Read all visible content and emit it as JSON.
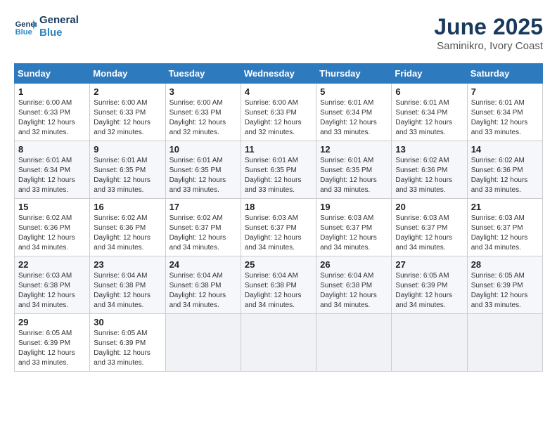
{
  "header": {
    "logo_line1": "General",
    "logo_line2": "Blue",
    "month": "June 2025",
    "location": "Saminikro, Ivory Coast"
  },
  "weekdays": [
    "Sunday",
    "Monday",
    "Tuesday",
    "Wednesday",
    "Thursday",
    "Friday",
    "Saturday"
  ],
  "weeks": [
    [
      {
        "day": "1",
        "info": "Sunrise: 6:00 AM\nSunset: 6:33 PM\nDaylight: 12 hours\nand 32 minutes."
      },
      {
        "day": "2",
        "info": "Sunrise: 6:00 AM\nSunset: 6:33 PM\nDaylight: 12 hours\nand 32 minutes."
      },
      {
        "day": "3",
        "info": "Sunrise: 6:00 AM\nSunset: 6:33 PM\nDaylight: 12 hours\nand 32 minutes."
      },
      {
        "day": "4",
        "info": "Sunrise: 6:00 AM\nSunset: 6:33 PM\nDaylight: 12 hours\nand 32 minutes."
      },
      {
        "day": "5",
        "info": "Sunrise: 6:01 AM\nSunset: 6:34 PM\nDaylight: 12 hours\nand 33 minutes."
      },
      {
        "day": "6",
        "info": "Sunrise: 6:01 AM\nSunset: 6:34 PM\nDaylight: 12 hours\nand 33 minutes."
      },
      {
        "day": "7",
        "info": "Sunrise: 6:01 AM\nSunset: 6:34 PM\nDaylight: 12 hours\nand 33 minutes."
      }
    ],
    [
      {
        "day": "8",
        "info": "Sunrise: 6:01 AM\nSunset: 6:34 PM\nDaylight: 12 hours\nand 33 minutes."
      },
      {
        "day": "9",
        "info": "Sunrise: 6:01 AM\nSunset: 6:35 PM\nDaylight: 12 hours\nand 33 minutes."
      },
      {
        "day": "10",
        "info": "Sunrise: 6:01 AM\nSunset: 6:35 PM\nDaylight: 12 hours\nand 33 minutes."
      },
      {
        "day": "11",
        "info": "Sunrise: 6:01 AM\nSunset: 6:35 PM\nDaylight: 12 hours\nand 33 minutes."
      },
      {
        "day": "12",
        "info": "Sunrise: 6:01 AM\nSunset: 6:35 PM\nDaylight: 12 hours\nand 33 minutes."
      },
      {
        "day": "13",
        "info": "Sunrise: 6:02 AM\nSunset: 6:36 PM\nDaylight: 12 hours\nand 33 minutes."
      },
      {
        "day": "14",
        "info": "Sunrise: 6:02 AM\nSunset: 6:36 PM\nDaylight: 12 hours\nand 33 minutes."
      }
    ],
    [
      {
        "day": "15",
        "info": "Sunrise: 6:02 AM\nSunset: 6:36 PM\nDaylight: 12 hours\nand 34 minutes."
      },
      {
        "day": "16",
        "info": "Sunrise: 6:02 AM\nSunset: 6:36 PM\nDaylight: 12 hours\nand 34 minutes."
      },
      {
        "day": "17",
        "info": "Sunrise: 6:02 AM\nSunset: 6:37 PM\nDaylight: 12 hours\nand 34 minutes."
      },
      {
        "day": "18",
        "info": "Sunrise: 6:03 AM\nSunset: 6:37 PM\nDaylight: 12 hours\nand 34 minutes."
      },
      {
        "day": "19",
        "info": "Sunrise: 6:03 AM\nSunset: 6:37 PM\nDaylight: 12 hours\nand 34 minutes."
      },
      {
        "day": "20",
        "info": "Sunrise: 6:03 AM\nSunset: 6:37 PM\nDaylight: 12 hours\nand 34 minutes."
      },
      {
        "day": "21",
        "info": "Sunrise: 6:03 AM\nSunset: 6:37 PM\nDaylight: 12 hours\nand 34 minutes."
      }
    ],
    [
      {
        "day": "22",
        "info": "Sunrise: 6:03 AM\nSunset: 6:38 PM\nDaylight: 12 hours\nand 34 minutes."
      },
      {
        "day": "23",
        "info": "Sunrise: 6:04 AM\nSunset: 6:38 PM\nDaylight: 12 hours\nand 34 minutes."
      },
      {
        "day": "24",
        "info": "Sunrise: 6:04 AM\nSunset: 6:38 PM\nDaylight: 12 hours\nand 34 minutes."
      },
      {
        "day": "25",
        "info": "Sunrise: 6:04 AM\nSunset: 6:38 PM\nDaylight: 12 hours\nand 34 minutes."
      },
      {
        "day": "26",
        "info": "Sunrise: 6:04 AM\nSunset: 6:38 PM\nDaylight: 12 hours\nand 34 minutes."
      },
      {
        "day": "27",
        "info": "Sunrise: 6:05 AM\nSunset: 6:39 PM\nDaylight: 12 hours\nand 34 minutes."
      },
      {
        "day": "28",
        "info": "Sunrise: 6:05 AM\nSunset: 6:39 PM\nDaylight: 12 hours\nand 33 minutes."
      }
    ],
    [
      {
        "day": "29",
        "info": "Sunrise: 6:05 AM\nSunset: 6:39 PM\nDaylight: 12 hours\nand 33 minutes."
      },
      {
        "day": "30",
        "info": "Sunrise: 6:05 AM\nSunset: 6:39 PM\nDaylight: 12 hours\nand 33 minutes."
      },
      {
        "day": "",
        "info": ""
      },
      {
        "day": "",
        "info": ""
      },
      {
        "day": "",
        "info": ""
      },
      {
        "day": "",
        "info": ""
      },
      {
        "day": "",
        "info": ""
      }
    ]
  ]
}
